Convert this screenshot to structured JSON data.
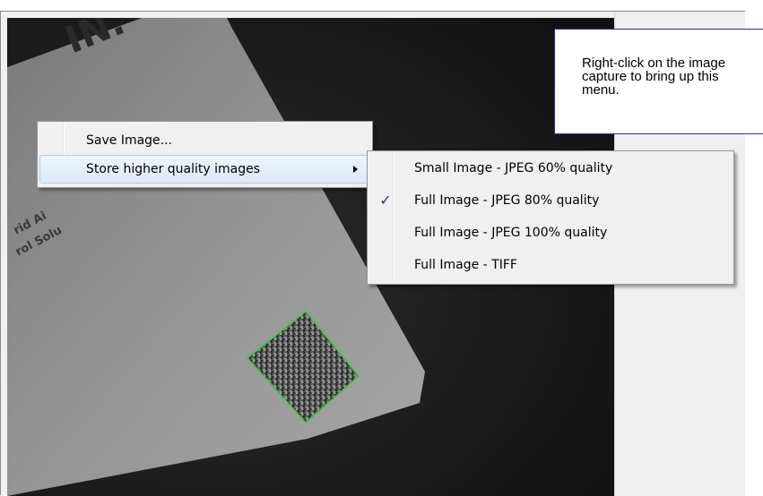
{
  "callout": {
    "text": "Right-click on the image capture to bring up this menu."
  },
  "context_menu": {
    "items": [
      {
        "label": "Save Image...",
        "has_submenu": false,
        "highlighted": false
      },
      {
        "label": "Store higher quality images",
        "has_submenu": true,
        "highlighted": true
      }
    ]
  },
  "submenu": {
    "items": [
      {
        "label": "Small Image - JPEG 60% quality",
        "checked": false
      },
      {
        "label": "Full Image - JPEG 80% quality",
        "checked": true
      },
      {
        "label": "Full Image - JPEG 100% quality",
        "checked": false
      },
      {
        "label": "Full Image - TIFF",
        "checked": false
      }
    ],
    "check_glyph": "✓"
  },
  "colors": {
    "symbol_outline": "#2ecc2e",
    "callout_border": "#2f2f9a"
  }
}
